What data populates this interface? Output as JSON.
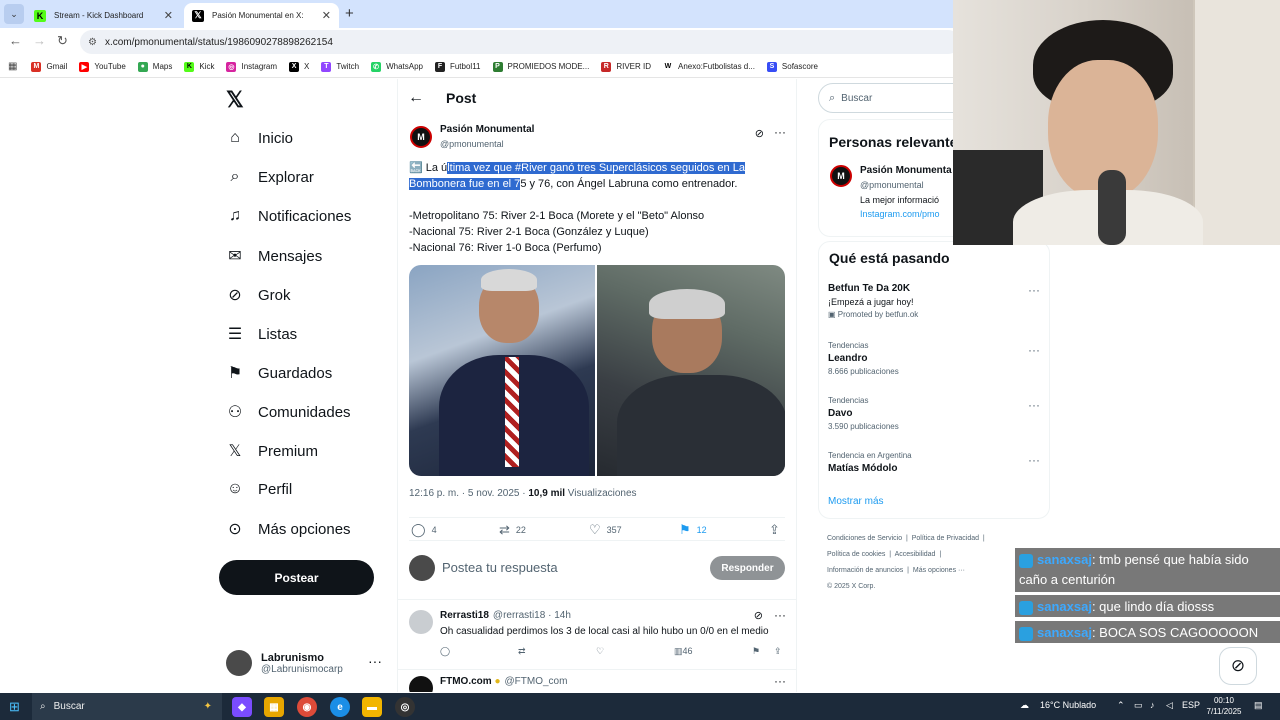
{
  "browser": {
    "tabs": [
      {
        "title": "Stream - Kick Dashboard",
        "active": false
      },
      {
        "title": "Pasión Monumental en X:",
        "active": true
      }
    ],
    "url": "x.com/pmonumental/status/1986090278898262154",
    "bookmarks": [
      "Gmail",
      "YouTube",
      "Maps",
      "Kick",
      "Instagram",
      "X",
      "Twitch",
      "WhatsApp",
      "Futbol11",
      "PROMIEDOS MODE...",
      "RIVER ID",
      "Anexo:Futbolistas d...",
      "Sofascore"
    ]
  },
  "left_nav": {
    "items": [
      "Inicio",
      "Explorar",
      "Notificaciones",
      "Mensajes",
      "Grok",
      "Listas",
      "Guardados",
      "Comunidades",
      "Premium",
      "Perfil",
      "Más opciones"
    ],
    "post_button": "Postear",
    "account": {
      "name": "Labrunismo",
      "handle": "@Labrunismocarp"
    }
  },
  "post": {
    "header_title": "Post",
    "author_name": "Pasión Monumental",
    "author_handle": "@pmonumental",
    "avatar_letter": "M",
    "text_pre": "La ú",
    "text_highlight_1": "ltima vez que #River ganó tres Superclásicos seguidos en La",
    "text_highlight_2": "Bombonera fue en el 7",
    "text_post": "5 y 76, con Ángel Labruna como entrenador.",
    "lines": [
      "-Metropolitano 75: River 2-1 Boca (Morete y el \"Beto\" Alonso",
      "-Nacional 75: River 2-1 Boca (González y Luque)",
      "-Nacional 76: River 1-0 Boca (Perfumo)"
    ],
    "time": "12:16 p. m. · 5 nov. 2025 · ",
    "views_count": "10,9 mil",
    "views_label": " Visualizaciones",
    "replies": "4",
    "reposts": "22",
    "likes": "357",
    "bookmarks": "12",
    "reply_placeholder": "Postea tu respuesta",
    "reply_button": "Responder"
  },
  "replies": [
    {
      "name": "Rerrasti18",
      "handle": "@rerrasti18 · 14h",
      "text": "Oh casualidad perdimos los 3 de local casi al hilo hubo un 0/0 en el medio",
      "views": "46"
    },
    {
      "name": "FTMO.com",
      "handle": "@FTMO_com",
      "text": ""
    }
  ],
  "right_col": {
    "search_placeholder": "Buscar",
    "relevant_title": "Personas relevante",
    "relevant_name": "Pasión Monumenta",
    "relevant_handle": "@pmonumental",
    "relevant_bio": "La mejor informació",
    "relevant_link": "Instagram.com/pmo",
    "trending_title": "Qué está pasando",
    "trends": [
      {
        "small": "",
        "name": "Betfun Te Da 20K",
        "sub": "¡Empezá a jugar hoy!",
        "promo": "Promoted by betfun.ok"
      },
      {
        "small": "Tendencias",
        "name": "Leandro",
        "sub": "8.666 publicaciones"
      },
      {
        "small": "Tendencias",
        "name": "Davo",
        "sub": "3.590 publicaciones"
      },
      {
        "small": "Tendencia en Argentina",
        "name": "Matías Módolo",
        "sub": ""
      }
    ],
    "show_more": "Mostrar más",
    "footer": [
      "Condiciones de Servicio",
      "Política de Privacidad",
      "Política de cookies",
      "Accesibilidad",
      "Información de anuncios",
      "Más opciones ···",
      "© 2025 X Corp."
    ]
  },
  "chat": [
    {
      "user": "sanaxsaj",
      "msg": ": tmb pensé que había sido caño a centurión"
    },
    {
      "user": "sanaxsaj",
      "msg": ": que lindo día diosss"
    },
    {
      "user": "sanaxsaj",
      "msg": ": BOCA SOS CAGOOOOON"
    }
  ],
  "taskbar": {
    "search": "Buscar",
    "weather": "16°C  Nublado",
    "lang": "ESP",
    "time": "00:10",
    "date": "7/11/2025"
  },
  "colors": {
    "accent": "#1d9bf0",
    "highlight": "#2f6ad0",
    "tabbar": "#d3e3fd",
    "taskbar": "#1c2a3a"
  }
}
